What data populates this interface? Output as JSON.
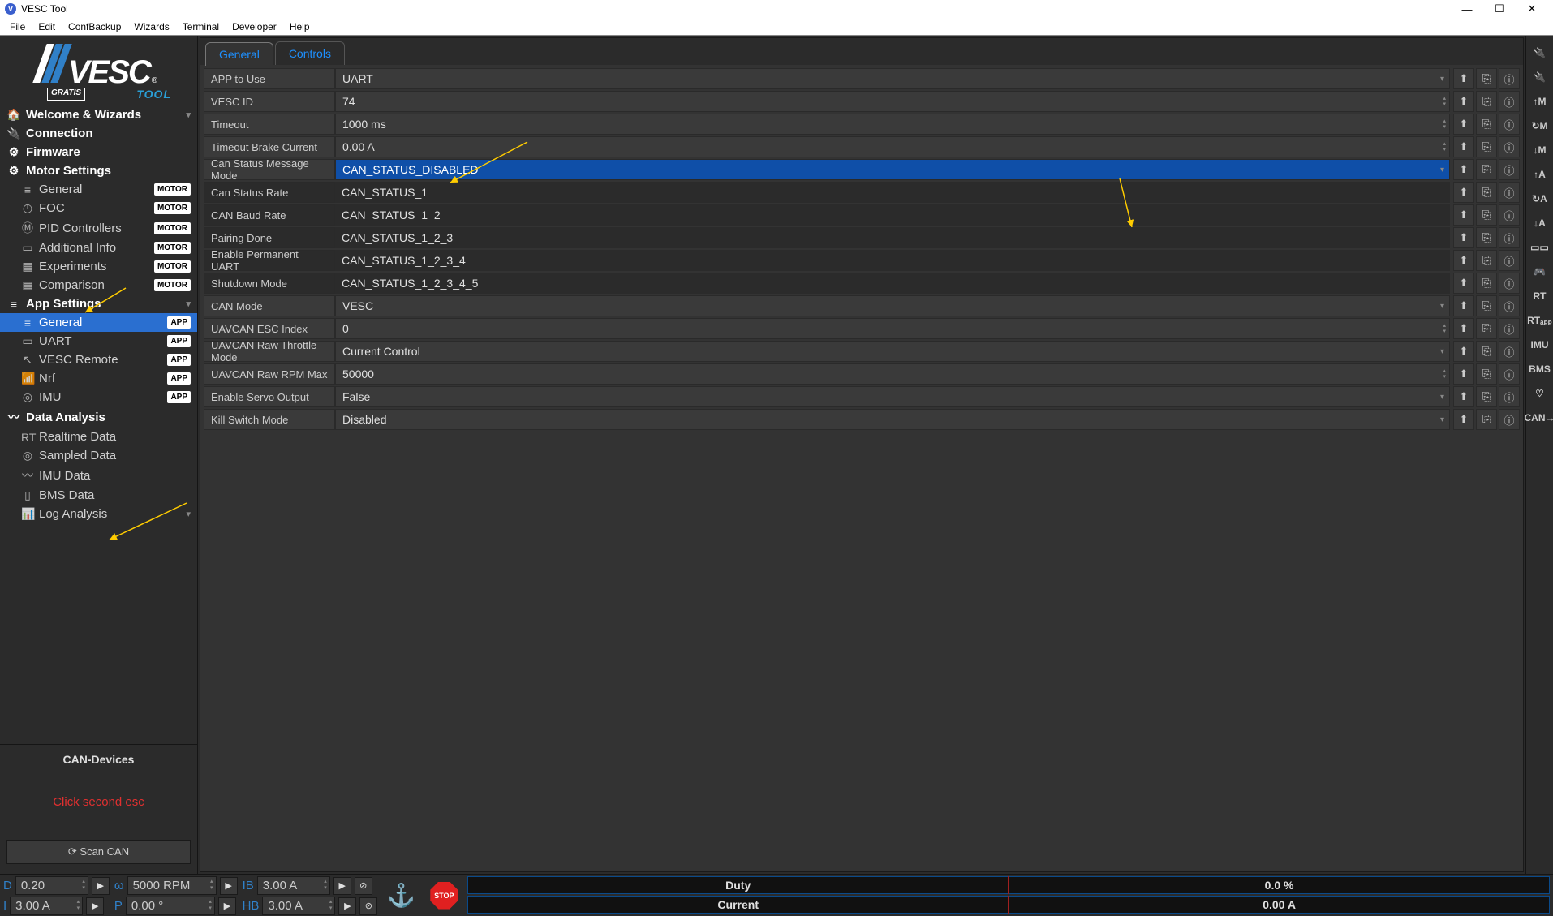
{
  "window": {
    "title": "VESC Tool"
  },
  "menu": [
    "File",
    "Edit",
    "ConfBackup",
    "Wizards",
    "Terminal",
    "Developer",
    "Help"
  ],
  "logo": {
    "brand": "VESC",
    "gratis": "GRATIS",
    "tool": "TOOL",
    "reg": "®"
  },
  "sidebar": {
    "items": [
      {
        "icon": "🏠",
        "label": "Welcome & Wizards",
        "header": true,
        "badge": "",
        "chevron": true
      },
      {
        "icon": "🔌",
        "label": "Connection",
        "header": true
      },
      {
        "icon": "⚙",
        "label": "Firmware",
        "header": true
      },
      {
        "icon": "⚙",
        "label": "Motor Settings",
        "header": true
      },
      {
        "icon": "≡",
        "label": "General",
        "sub": true,
        "badge": "MOTOR"
      },
      {
        "icon": "◷",
        "label": "FOC",
        "sub": true,
        "badge": "MOTOR"
      },
      {
        "icon": "Ⓜ",
        "label": "PID Controllers",
        "sub": true,
        "badge": "MOTOR"
      },
      {
        "icon": "▭",
        "label": "Additional Info",
        "sub": true,
        "badge": "MOTOR"
      },
      {
        "icon": "▦",
        "label": "Experiments",
        "sub": true,
        "badge": "MOTOR"
      },
      {
        "icon": "▦",
        "label": "Comparison",
        "sub": true,
        "badge": "MOTOR"
      },
      {
        "icon": "≡",
        "label": "App Settings",
        "header": true,
        "chevron": true
      },
      {
        "icon": "≡",
        "label": "General",
        "sub": true,
        "badge": "APP",
        "active": true
      },
      {
        "icon": "▭",
        "label": "UART",
        "sub": true,
        "badge": "APP"
      },
      {
        "icon": "↖",
        "label": "VESC Remote",
        "sub": true,
        "badge": "APP"
      },
      {
        "icon": "📶",
        "label": "Nrf",
        "sub": true,
        "badge": "APP"
      },
      {
        "icon": "◎",
        "label": "IMU",
        "sub": true,
        "badge": "APP"
      },
      {
        "icon": "〰",
        "label": "Data Analysis",
        "header": true
      },
      {
        "icon": "RT",
        "label": "Realtime Data",
        "sub": true
      },
      {
        "icon": "◎",
        "label": "Sampled Data",
        "sub": true
      },
      {
        "icon": "〰",
        "label": "IMU Data",
        "sub": true
      },
      {
        "icon": "▯",
        "label": "BMS Data",
        "sub": true
      },
      {
        "icon": "📊",
        "label": "Log Analysis",
        "sub": true,
        "chevron": true
      }
    ],
    "can_header": "CAN-Devices",
    "can_text": "Click second esc",
    "scan_label": "⟳ Scan CAN"
  },
  "tabs": [
    {
      "label": "General",
      "active": true
    },
    {
      "label": "Controls",
      "active": false
    }
  ],
  "rows": [
    {
      "label": "APP to Use",
      "value": "UART",
      "type": "dropdown"
    },
    {
      "label": "VESC ID",
      "value": "74",
      "type": "spin"
    },
    {
      "label": "Timeout",
      "value": "1000 ms",
      "type": "spin"
    },
    {
      "label": "Timeout Brake Current",
      "value": "0.00 A",
      "type": "spin"
    },
    {
      "label": "Can Status Message Mode",
      "value": "CAN_STATUS_DISABLED",
      "type": "dropdown",
      "highlight": true
    },
    {
      "label": "Can Status Rate",
      "value": "CAN_STATUS_1",
      "type": "list"
    },
    {
      "label": "CAN Baud Rate",
      "value": "CAN_STATUS_1_2",
      "type": "list"
    },
    {
      "label": "Pairing Done",
      "value": "CAN_STATUS_1_2_3",
      "type": "list"
    },
    {
      "label": "Enable Permanent UART",
      "value": "CAN_STATUS_1_2_3_4",
      "type": "list"
    },
    {
      "label": "Shutdown Mode",
      "value": "CAN_STATUS_1_2_3_4_5",
      "type": "list"
    },
    {
      "label": "CAN Mode",
      "value": "VESC",
      "type": "dropdown"
    },
    {
      "label": "UAVCAN ESC Index",
      "value": "0",
      "type": "spin"
    },
    {
      "label": "UAVCAN Raw Throttle Mode",
      "value": "Current Control",
      "type": "dropdown"
    },
    {
      "label": "UAVCAN Raw RPM Max",
      "value": "50000",
      "type": "spin"
    },
    {
      "label": "Enable Servo Output",
      "value": "False",
      "type": "dropdown"
    },
    {
      "label": "Kill Switch Mode",
      "value": "Disabled",
      "type": "dropdown"
    }
  ],
  "row_buttons": [
    "⬆",
    "⎘",
    "ⓘ"
  ],
  "right_toolbar": [
    "🔌",
    "🔌",
    "↑M",
    "↻M",
    "↓M",
    "↑A",
    "↻A",
    "↓A",
    "▭▭",
    "🎮",
    "RT",
    "RTₐₚₚ",
    "IMU",
    "BMS",
    "♡",
    "CAN→"
  ],
  "status": {
    "D": {
      "label": "D",
      "value": "0.20"
    },
    "I": {
      "label": "I",
      "value": "3.00 A"
    },
    "w": {
      "label": "ω",
      "value": "5000 RPM"
    },
    "P": {
      "label": "P",
      "value": "0.00 °"
    },
    "IB": {
      "label": "IB",
      "value": "3.00 A"
    },
    "HB": {
      "label": "HB",
      "value": "3.00 A"
    },
    "stop": "STOP",
    "duty_label": "Duty",
    "duty_value": "0.0 %",
    "current_label": "Current",
    "current_value": "0.00 A"
  }
}
